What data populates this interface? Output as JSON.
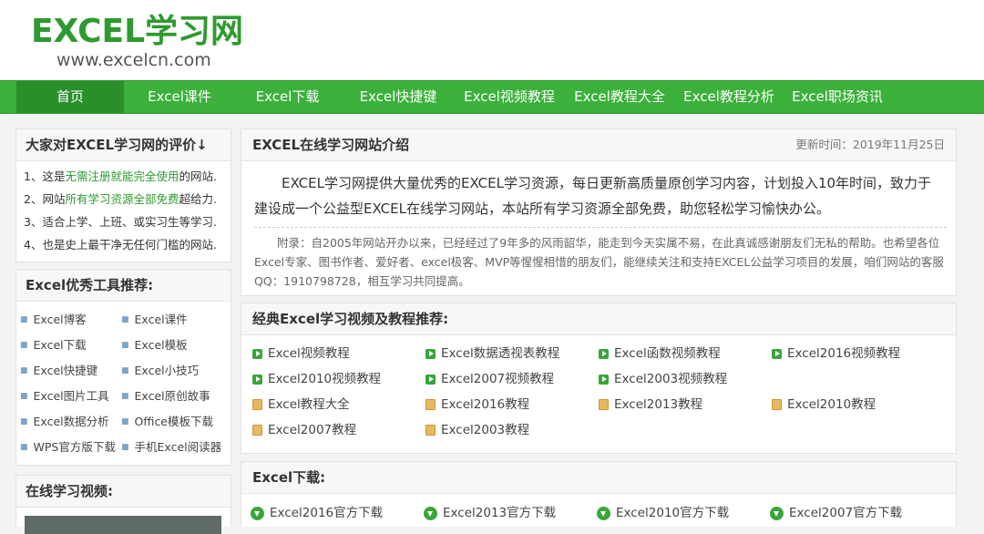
{
  "header": {
    "logo_title": "EXCEL学习网",
    "logo_url": "www.excelcn.com"
  },
  "nav": {
    "items": [
      "首页",
      "Excel课件",
      "Excel下载",
      "Excel快捷键",
      "Excel视频教程",
      "Excel教程大全",
      "Excel教程分析",
      "Excel职场资讯"
    ],
    "active": "首页"
  },
  "evaluation": {
    "title": "大家对EXCEL学习网的评价↓",
    "items": [
      {
        "prefix": "1、这是",
        "highlight": "无需注册就能完全使用",
        "suffix": "的网站."
      },
      {
        "prefix": "2、网站",
        "highlight": "所有学习资源全部免费",
        "suffix": "超给力."
      },
      {
        "prefix": "3、适合上学、上班、或实习生等学习.",
        "highlight": "",
        "suffix": ""
      },
      {
        "prefix": "4、也是史上最干净无任何门槛的网站.",
        "highlight": "",
        "suffix": ""
      }
    ]
  },
  "tools": {
    "title": "Excel优秀工具推荐:",
    "items": [
      "Excel博客",
      "Excel课件",
      "Excel下载",
      "Excel模板",
      "Excel快捷键",
      "Excel小技巧",
      "Excel图片工具",
      "Excel原创故事",
      "Excel数据分析",
      "Office模板下载",
      "WPS官方版下载",
      "手机Excel阅读器"
    ]
  },
  "online_video": {
    "title": "在线学习视频:"
  },
  "intro": {
    "title": "EXCEL在线学习网站介绍",
    "update_time": "更新时间：2019年11月25日",
    "paragraph": "EXCEL学习网提供大量优秀的EXCEL学习资源，每日更新高质量原创学习内容，计划投入10年时间，致力于建设成一个公益型EXCEL在线学习网站，本站所有学习资源全部免费，助您轻松学习愉快办公。",
    "note": "附录：自2005年网站开办以来，已经经过了9年多的风雨韶华，能走到今天实属不易，在此真诚感谢朋友们无私的帮助。也希望各位Excel专家、图书作者、爱好者、excel极客、MVP等惺惺相惜的朋友们，能继续关注和支持EXCEL公益学习项目的发展，咱们网站的客服QQ：1910798728，相互学习共同提高。"
  },
  "courses": {
    "title": "经典Excel学习视频及教程推荐:",
    "video_items": [
      "Excel视频教程",
      "Excel数据透视表教程",
      "Excel函数视频教程",
      "Excel2016视频教程",
      "Excel2010视频教程",
      "Excel2007视频教程",
      "Excel2003视频教程"
    ],
    "book_items": [
      "Excel教程大全",
      "Excel2016教程",
      "Excel2013教程",
      "Excel2010教程",
      "Excel2007教程",
      "Excel2003教程"
    ],
    "video_icon": "play-icon",
    "book_icon": "book-icon"
  },
  "downloads": {
    "title": "Excel下载:",
    "items": [
      "Excel2016官方下载",
      "Excel2013官方下载",
      "Excel2010官方下载",
      "Excel2007官方下载"
    ],
    "icon": "download-icon"
  },
  "colors": {
    "brand_green": "#2f9a2f",
    "nav_green": "#3bb03b",
    "nav_active": "#2a8f2a"
  }
}
